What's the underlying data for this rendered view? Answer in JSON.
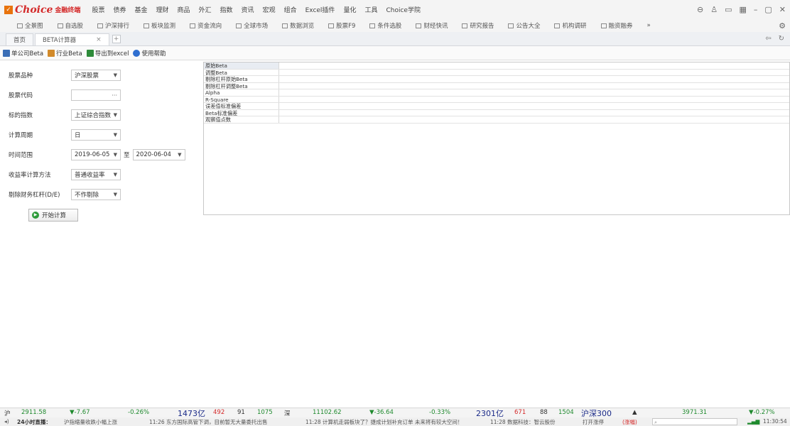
{
  "app": {
    "logo_text": "Choice",
    "logo_sub": "金融终端",
    "menu": [
      "股票",
      "债券",
      "基金",
      "理财",
      "商品",
      "外汇",
      "指数",
      "资讯",
      "宏观",
      "组合",
      "Excel插件",
      "量化",
      "工具",
      "Choice学院"
    ],
    "window_icons": [
      "⊖",
      "♙",
      "▭",
      "▦",
      "–",
      "▢",
      "✕"
    ]
  },
  "quickbar": [
    "全景图",
    "自选股",
    "沪深排行",
    "板块监测",
    "资金流向",
    "全球市场",
    "数据浏览",
    "股票F9",
    "条件选股",
    "财经快讯",
    "研究报告",
    "公告大全",
    "机构调研",
    "融资融券"
  ],
  "quickbar_more": "»",
  "tabs": [
    {
      "label": "首页",
      "closable": false,
      "active": false
    },
    {
      "label": "BETA计算器",
      "closable": true,
      "active": true
    }
  ],
  "tab_close": "×",
  "tab_add": "+",
  "nav": {
    "back": "⇦",
    "refresh": "↻"
  },
  "toolbar": {
    "single_beta": "单公司Beta",
    "industry_beta": "行业Beta",
    "export_excel": "导出到excel",
    "help": "使用帮助"
  },
  "form": {
    "stock_type_label": "股票品种",
    "stock_type_value": "沪深股票",
    "stock_code_label": "股票代码",
    "stock_code_value": "",
    "benchmark_label": "标的指数",
    "benchmark_value": "上证综合指数",
    "period_label": "计算周期",
    "period_value": "日",
    "time_range_label": "时间范围",
    "date_start": "2019-06-05",
    "to_label": "至",
    "date_end": "2020-06-04",
    "return_method_label": "收益率计算方法",
    "return_method_value": "普通收益率",
    "leverage_label": "剔除财务杠杆(D/E)",
    "leverage_value": "不作剔除",
    "calc_button": "开始计算"
  },
  "results_rows": [
    "原始Beta",
    "调整Beta",
    "剔除杠杆原始Beta",
    "剔除杠杆调整Beta",
    "Alpha",
    "R-Square",
    "误差值标准偏差",
    "Beta标准偏差",
    "观察值点数"
  ],
  "ticker": {
    "sh_label": "沪",
    "sh_index": "2911.58",
    "sh_change": "▼-7.67",
    "sh_pct": "-0.26%",
    "sh_volume": "1473亿",
    "sh_up": "492",
    "sh_flat": "91",
    "sh_down": "1075",
    "sz_label": "深",
    "sz_index": "11102.62",
    "sz_change": "▼-36.64",
    "sz_pct": "-0.33%",
    "sz_volume": "2301亿",
    "sz_up": "671",
    "sz_flat": "88",
    "sz_down": "1504",
    "hs300_label": "沪深300",
    "hs300_arrow": "▲",
    "hs300_index": "3971.31",
    "hs300_pct": "▼-0.27%"
  },
  "newsbar": {
    "title": "24小时直播：",
    "headline": "沪指缩量收跌小幅上涨",
    "item1": "11:26 东方国际高管下调，目前暂无大量委托出售",
    "item2": "11:28 计算机走弱板块了？捷成计划补充订单 未来将有较大空间！",
    "item3": "11:28 数据科技：智云股份",
    "item4": "打开涨停",
    "item5": "(涨幅)",
    "time": "11:30:54"
  },
  "colors": {
    "brand": "#d42a2a",
    "up": "#d42a2a",
    "down": "#1f8a2e"
  }
}
